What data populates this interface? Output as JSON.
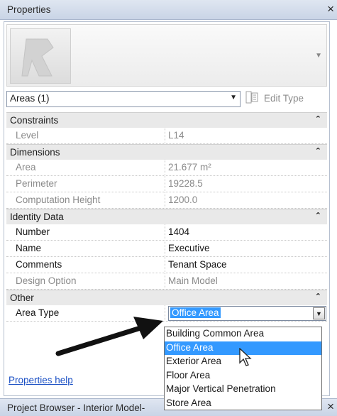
{
  "header": {
    "title": "Properties",
    "close": "×"
  },
  "type_selector": {
    "value": "Areas (1)",
    "edit_type": "Edit Type"
  },
  "categories": [
    {
      "name": "Constraints",
      "rows": [
        {
          "name": "Level",
          "value": "L14"
        }
      ]
    },
    {
      "name": "Dimensions",
      "rows": [
        {
          "name": "Area",
          "value": "21.677 m²"
        },
        {
          "name": "Perimeter",
          "value": "19228.5"
        },
        {
          "name": "Computation Height",
          "value": "1200.0"
        }
      ]
    },
    {
      "name": "Identity Data",
      "rows": [
        {
          "name": "Number",
          "value": "1404"
        },
        {
          "name": "Name",
          "value": "Executive"
        },
        {
          "name": "Comments",
          "value": "Tenant Space"
        },
        {
          "name": "Design Option",
          "value": "Main Model"
        }
      ]
    },
    {
      "name": "Other",
      "rows": [
        {
          "name": "Area Type",
          "value": "Office Area"
        }
      ]
    }
  ],
  "dropdown": {
    "options": [
      "Building Common Area",
      "Office Area",
      "Exterior Area",
      "Floor Area",
      "Major Vertical Penetration",
      "Store Area"
    ],
    "highlighted": "Office Area"
  },
  "footer": {
    "help_link": "Properties help",
    "project_browser_title": "Project Browser - Interior Model-",
    "close": "×"
  },
  "icons": {
    "collapse": "chevron-up-double-icon",
    "dropdown": "triangle-down-icon",
    "edit_type": "edit-type-icon",
    "cursor": "mouse-pointer-icon",
    "annotation": "arrow-annotation-icon"
  }
}
